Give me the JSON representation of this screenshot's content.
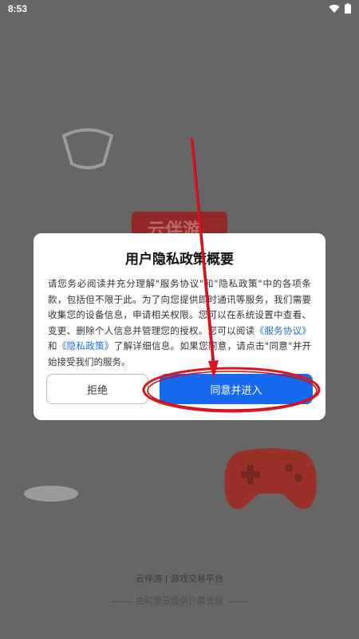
{
  "status_bar": {
    "time": "8:53",
    "icons": [
      "wifi-icon",
      "battery-icon"
    ]
  },
  "background": {
    "banner_text": "云伴游",
    "footer_brand": "云伴游  |  游戏交易平台",
    "footer_support": "由阿里云提供计算支持"
  },
  "dialog": {
    "title": "用户隐私政策概要",
    "body_part1": "请您务必阅读并充分理解\"服务协议\"和\"隐私政策\"中的各项条款，包括但不限于此。为了向您提供即时通讯等服务，我们需要收集您的设备信息，申请相关权限。您可以在系统设置中查看、变更、删除个人信息并管理您的授权。您可以阅读",
    "link_service": "《服务协议》",
    "and": "和",
    "link_privacy": "《隐私政策》",
    "body_part2": "了解详细信息。如果您同意，请点击\"同意\"并开始接受我们的服务。",
    "reject_label": "拒绝",
    "accept_label": "同意并进入"
  },
  "colors": {
    "accent": "#1769f0",
    "link": "#1e6fe0",
    "annotation": "#e0141e",
    "overlay": "#666666"
  }
}
